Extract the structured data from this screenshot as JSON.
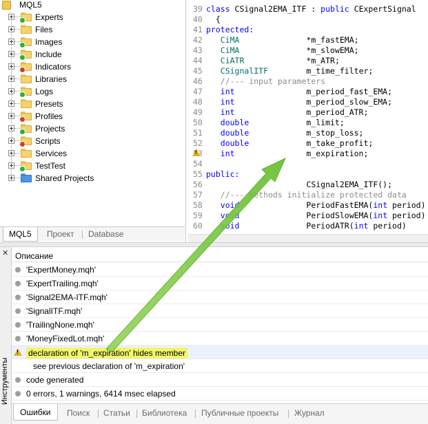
{
  "navigator": {
    "root_label": "MQL5",
    "items": [
      {
        "label": "Experts",
        "badge": "green",
        "folder": "yellow"
      },
      {
        "label": "Files",
        "badge": "",
        "folder": "yellow"
      },
      {
        "label": "Images",
        "badge": "green",
        "folder": "yellow"
      },
      {
        "label": "Include",
        "badge": "green",
        "folder": "yellow"
      },
      {
        "label": "Indicators",
        "badge": "red",
        "folder": "yellow"
      },
      {
        "label": "Libraries",
        "badge": "",
        "folder": "yellow"
      },
      {
        "label": "Logs",
        "badge": "green",
        "folder": "yellow"
      },
      {
        "label": "Presets",
        "badge": "",
        "folder": "yellow"
      },
      {
        "label": "Profiles",
        "badge": "red",
        "folder": "yellow"
      },
      {
        "label": "Projects",
        "badge": "green",
        "folder": "yellow"
      },
      {
        "label": "Scripts",
        "badge": "red",
        "folder": "yellow"
      },
      {
        "label": "Services",
        "badge": "",
        "folder": "yellow"
      },
      {
        "label": "TestTest",
        "badge": "green",
        "folder": "yellow"
      },
      {
        "label": "Shared Projects",
        "badge": "",
        "folder": "blue"
      }
    ],
    "tabs": [
      "MQL5",
      "Проект",
      "Database"
    ]
  },
  "editor": {
    "lines": [
      {
        "n": "39",
        "parts": [
          [
            "kw",
            "class "
          ],
          [
            "",
            "CSignal2EMA_ITF : "
          ],
          [
            "kw",
            "public "
          ],
          [
            "",
            "CExpertSignal"
          ]
        ]
      },
      {
        "n": "40",
        "parts": [
          [
            "",
            "  {"
          ]
        ]
      },
      {
        "n": "41",
        "parts": [
          [
            "kw",
            "protected:"
          ]
        ]
      },
      {
        "n": "42",
        "parts": [
          [
            "tp",
            "   CiMA"
          ],
          [
            "",
            "              *m_fastEMA;"
          ]
        ]
      },
      {
        "n": "43",
        "parts": [
          [
            "tp",
            "   CiMA"
          ],
          [
            "",
            "              *m_slowEMA;"
          ]
        ]
      },
      {
        "n": "44",
        "parts": [
          [
            "tp",
            "   CiATR"
          ],
          [
            "",
            "             *m_ATR;"
          ]
        ]
      },
      {
        "n": "45",
        "parts": [
          [
            "tp",
            "   CSignalITF"
          ],
          [
            "",
            "        m_time_filter;"
          ]
        ]
      },
      {
        "n": "46",
        "parts": [
          [
            "cm",
            "   //--- input parameters"
          ]
        ]
      },
      {
        "n": "47",
        "parts": [
          [
            "kw",
            "   int"
          ],
          [
            "",
            "               m_period_fast_EMA;"
          ]
        ]
      },
      {
        "n": "48",
        "parts": [
          [
            "kw",
            "   int"
          ],
          [
            "",
            "               m_period_slow_EMA;"
          ]
        ]
      },
      {
        "n": "49",
        "parts": [
          [
            "kw",
            "   int"
          ],
          [
            "",
            "               m_period_ATR;"
          ]
        ]
      },
      {
        "n": "50",
        "parts": [
          [
            "kw",
            "   double"
          ],
          [
            "",
            "            m_limit;"
          ]
        ]
      },
      {
        "n": "51",
        "parts": [
          [
            "kw",
            "   double"
          ],
          [
            "",
            "            m_stop_loss;"
          ]
        ]
      },
      {
        "n": "52",
        "parts": [
          [
            "kw",
            "   double"
          ],
          [
            "",
            "            m_take_profit;"
          ]
        ]
      },
      {
        "n": "53",
        "parts": [
          [
            "kw",
            "   int"
          ],
          [
            "",
            "               m_expiration;"
          ]
        ]
      },
      {
        "n": "54",
        "parts": [
          [
            "",
            ""
          ]
        ]
      },
      {
        "n": "55",
        "parts": [
          [
            "kw",
            "public:"
          ]
        ]
      },
      {
        "n": "56",
        "parts": [
          [
            "",
            "                     CSignal2EMA_ITF();"
          ]
        ]
      },
      {
        "n": "57",
        "parts": [
          [
            "cm",
            "   //--- methods initialize protected data"
          ]
        ]
      },
      {
        "n": "58",
        "parts": [
          [
            "kw",
            "   void"
          ],
          [
            "",
            "              PeriodFastEMA("
          ],
          [
            "kw",
            "int"
          ],
          [
            "",
            " period)"
          ]
        ]
      },
      {
        "n": "59",
        "parts": [
          [
            "kw",
            "   void"
          ],
          [
            "",
            "              PeriodSlowEMA("
          ],
          [
            "kw",
            "int"
          ],
          [
            "",
            " period)"
          ]
        ]
      },
      {
        "n": "60",
        "parts": [
          [
            "kw",
            "   void"
          ],
          [
            "",
            "              PeriodATR("
          ],
          [
            "kw",
            "int"
          ],
          [
            "",
            " period)"
          ]
        ]
      }
    ]
  },
  "toolbox": {
    "side_label": "Инструменты",
    "column_header": "Описание",
    "messages": [
      {
        "kind": "info",
        "text": "'ExpertMoney.mqh'"
      },
      {
        "kind": "info",
        "text": "'ExpertTrailing.mqh'"
      },
      {
        "kind": "info",
        "text": "'Signal2EMA-ITF.mqh'"
      },
      {
        "kind": "info",
        "text": "'SignalITF.mqh'"
      },
      {
        "kind": "info",
        "text": "'TrailingNone.mqh'"
      },
      {
        "kind": "info",
        "text": "'MoneyFixedLot.mqh'"
      },
      {
        "kind": "warning",
        "text": "declaration of 'm_expiration' hides member"
      },
      {
        "kind": "detail",
        "text": "see previous declaration of 'm_expiration'"
      },
      {
        "kind": "info",
        "text": "code generated"
      },
      {
        "kind": "info",
        "text": "0 errors, 1 warnings, 6414 msec elapsed"
      }
    ],
    "tabs": [
      "Ошибки",
      "Поиск",
      "Статьи",
      "Библиотека",
      "Публичные проекты",
      "Журнал"
    ]
  },
  "colors": {
    "keyword": "#0000ff",
    "comment": "#8c8c8c",
    "type": "#007060",
    "warning_highlight": "#f3f56b",
    "annotation_arrow": "#8fd14f"
  }
}
